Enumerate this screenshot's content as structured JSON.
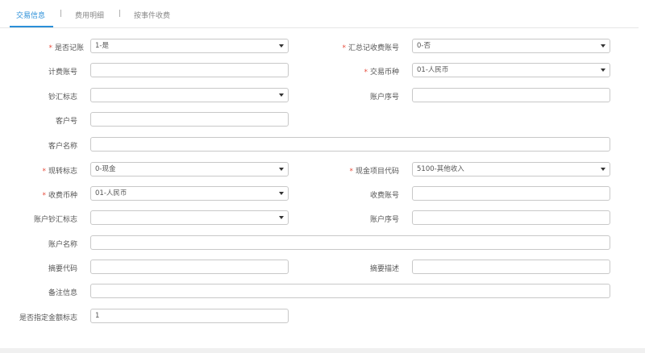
{
  "tabs": [
    {
      "label": "交易信息",
      "active": true
    },
    {
      "label": "费用明细",
      "active": false
    },
    {
      "label": "按事件收费",
      "active": false
    }
  ],
  "tab_separator": "|",
  "required_mark": "*",
  "form": {
    "is_book": {
      "label": "是否记账",
      "value": "1-是",
      "required": true
    },
    "summary_account": {
      "label": "汇总记收费账号",
      "value": "0-否",
      "required": true
    },
    "billing_account": {
      "label": "计费账号",
      "value": "",
      "required": false
    },
    "trade_currency": {
      "label": "交易币种",
      "value": "01-人民币",
      "required": true
    },
    "cash_remit_flag": {
      "label": "钞汇标志",
      "value": "",
      "required": false
    },
    "account_seq_1": {
      "label": "账户序号",
      "value": "",
      "required": false
    },
    "customer_no": {
      "label": "客户号",
      "value": "",
      "required": false
    },
    "customer_name": {
      "label": "客户名称",
      "value": "",
      "required": false
    },
    "cash_transfer_flag": {
      "label": "现转标志",
      "value": "0-现金",
      "required": true
    },
    "cash_item_code": {
      "label": "现金项目代码",
      "value": "5100-其他收入",
      "required": true
    },
    "fee_currency": {
      "label": "收费币种",
      "value": "01-人民币",
      "required": true
    },
    "fee_account": {
      "label": "收费账号",
      "value": "",
      "required": false
    },
    "account_cash_remit": {
      "label": "账户钞汇标志",
      "value": "",
      "required": false
    },
    "account_seq_2": {
      "label": "账户序号",
      "value": "",
      "required": false
    },
    "account_name": {
      "label": "账户名称",
      "value": "",
      "required": false
    },
    "summary_code": {
      "label": "摘要代码",
      "value": "",
      "required": false
    },
    "summary_desc": {
      "label": "摘要描述",
      "value": "",
      "required": false
    },
    "remark": {
      "label": "备注信息",
      "value": "",
      "required": false
    },
    "specified_amount_flag": {
      "label": "是否指定金额标志",
      "value": "1",
      "required": false
    }
  },
  "colors": {
    "accent": "#2a8fd8",
    "required": "#e74c3c",
    "border": "#c8c8c8"
  }
}
